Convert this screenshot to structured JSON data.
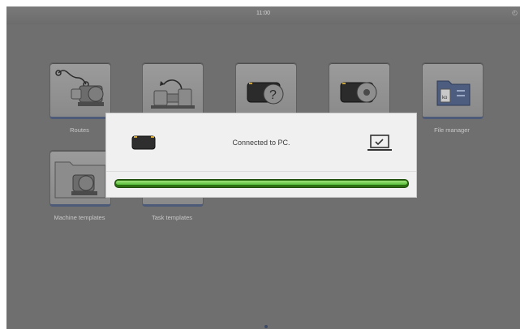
{
  "statusbar": {
    "time": "11:00",
    "status_icon": "clock-icon"
  },
  "tiles": [
    {
      "label": "Routes",
      "icon": "routes-motor-icon"
    },
    {
      "label": "",
      "icon": "measurement-cycle-icon"
    },
    {
      "label": "",
      "icon": "device-help-icon"
    },
    {
      "label": "",
      "icon": "device-settings-icon"
    },
    {
      "label": "File manager",
      "icon": "file-manager-icon"
    },
    {
      "label": "Machine templates",
      "icon": "machine-template-icon"
    },
    {
      "label": "Task templates",
      "icon": "task-template-icon"
    }
  ],
  "dialog": {
    "message": "Connected to PC.",
    "device_icon": "device-icon",
    "pc_icon": "laptop-check-icon",
    "progress": 1.0,
    "colors": {
      "progress_fill": "#58c23a",
      "progress_track": "#2e6e12"
    }
  },
  "pager": {
    "current_page": 1,
    "icon": "page-dot"
  }
}
